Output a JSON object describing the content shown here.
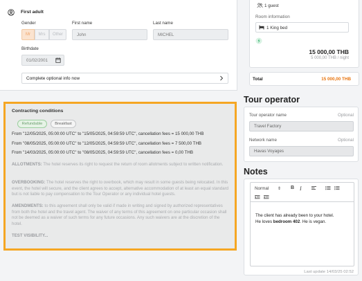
{
  "adult": {
    "title": "First adult",
    "gender_label": "Gender",
    "gender_options": [
      "Mr",
      "Mrs",
      "Other"
    ],
    "first_name_label": "First name",
    "first_name_value": "John",
    "last_name_label": "Last name",
    "last_name_value": "MICHEL",
    "birthdate_label": "Birthdate",
    "birthdate_value": "01/02/2001",
    "optional_link": "Complete optional info now"
  },
  "contract": {
    "title": "Contracting conditions",
    "badges": [
      "Refundable",
      "Breakfast"
    ],
    "fees": [
      "From \"12/05/2025, 05:00:00 UTC\" to \"15/05/2025, 04:59:59 UTC\", cancellation fees = 15 000,00 THB",
      "From \"08/05/2025, 05:00:00 UTC\" to \"12/05/2025, 04:59:59 UTC\", cancellation fees = 7 500,00 THB",
      "From \"14/03/2025, 05:00:00 UTC\" to \"08/05/2025, 04:59:59 UTC\", cancellation fees = 0,00 THB"
    ],
    "allotments_label": "ALLOTMENTS:",
    "allotments_text": " The hotel reserves its right to request the return of room allotments subject to written notification.",
    "overbooking_label": "OVERBOOKING:",
    "overbooking_text": " The hotel reserves the right to overbook, which may result in some guests being relocated. In this event, the hotel will secure, and the client agrees to accept, alternative accommodation of at least an equal standard but is not liable to pay compensation to the Tour Operator or any individual hotel guests.",
    "amendments_label": "AMENDMENTS:",
    "amendments_text": " to this agreement shall only be valid if made in writing and signed by authorized representatives from both the hotel and the travel agent. The waiver of any terms of this agreement on one particular occasion shall not be deemed as a waiver of such terms for any future occasions. Any such waivers are at the discretion of the hotel.",
    "visibility_label": "TEST VISIBILITY..."
  },
  "room": {
    "guests": "1 guest",
    "info_label": "Room information",
    "bed": "1 King bed",
    "price": "15 000,00 THB",
    "price_per_night": "5 000,00 THB / night",
    "total_label": "Total",
    "total_value": "15 000,00 THB"
  },
  "tour": {
    "title": "Tour operator",
    "name_label": "Tour operator name",
    "name_optional": "Optional",
    "name_value": "Travel Factory",
    "network_label": "Network name",
    "network_optional": "Optional",
    "network_value": "Havas Voyages"
  },
  "notes": {
    "title": "Notes",
    "format_select": "Normal",
    "line1": "The client has already been to your hotel.",
    "line2_prefix": "He loves ",
    "line2_bold": "bedroom 402",
    "line2_suffix": ". He is vegan.",
    "last_update": "Last update 14/03/25 02:52"
  },
  "colors": {
    "accent": "#f5a623",
    "total": "#e8730c",
    "green": "#2fb36a"
  }
}
